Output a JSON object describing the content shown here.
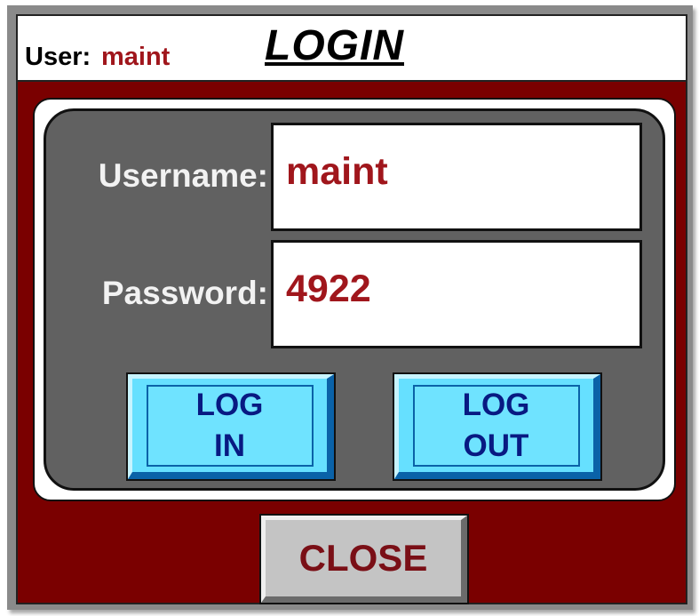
{
  "header": {
    "user_label": "User:",
    "user_value": "maint",
    "title": "LOGIN"
  },
  "form": {
    "username_label": "Username:",
    "username_value": "maint",
    "password_label": "Password:",
    "password_value": "4922"
  },
  "buttons": {
    "login_line1": "LOG",
    "login_line2": "IN",
    "logout_line1": "LOG",
    "logout_line2": "OUT",
    "close": "CLOSE"
  },
  "colors": {
    "background_red": "#7a0000",
    "panel_grey": "#616161",
    "value_red": "#a0161c",
    "button_blue": "#66e0ff",
    "button_text_blue": "#081a82",
    "close_grey": "#c4c4c4"
  }
}
